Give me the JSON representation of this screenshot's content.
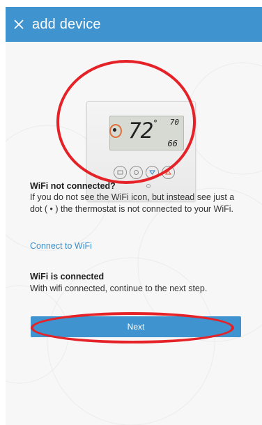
{
  "header": {
    "title": "add device",
    "close_icon": "close-icon"
  },
  "thermostat": {
    "display_temp": "72",
    "degree_symbol": "°",
    "setpoint_top": "70",
    "setpoint_bottom": "66",
    "buttons": [
      "menu-button",
      "fan-button",
      "down-button",
      "up-button"
    ]
  },
  "wifi_not_connected": {
    "title": "WiFi not connected?",
    "text": "If you do not see the WiFi icon, but instead see just a dot ( • ) the thermostat is not connected to your WiFi."
  },
  "connect_link": "Connect to WiFi",
  "wifi_connected": {
    "title": "WiFi is connected",
    "text": "With wifi connected, continue to the next step."
  },
  "next_button": "Next",
  "colors": {
    "accent": "#3f93cf",
    "annotation": "#e52227",
    "link": "#3d8ec9"
  }
}
